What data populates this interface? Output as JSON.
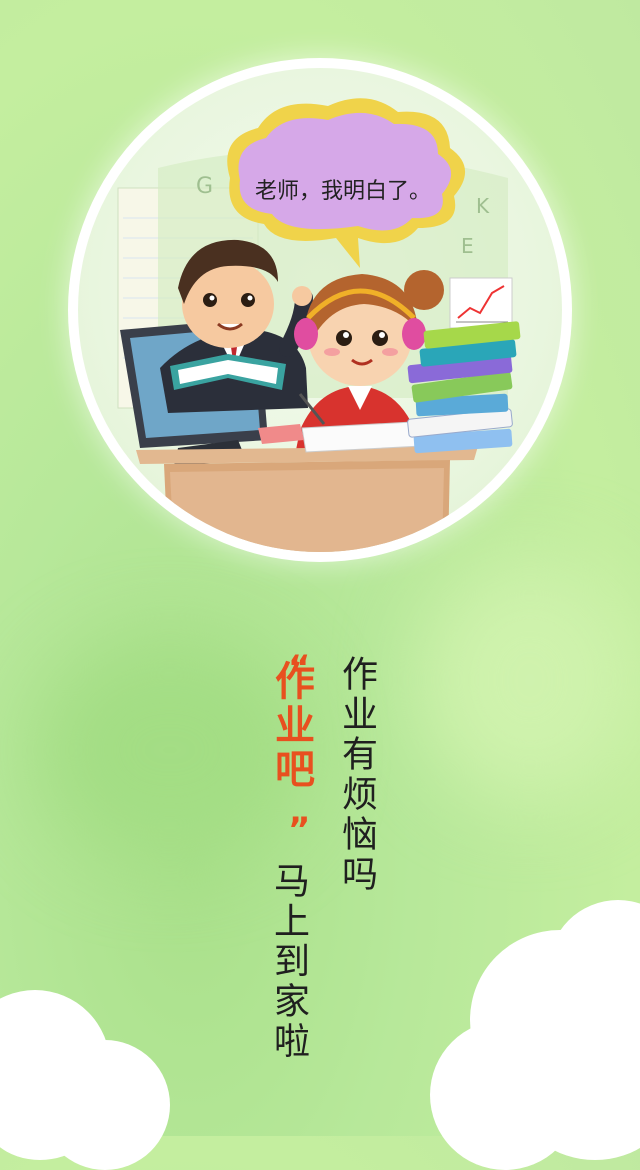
{
  "illustration": {
    "speech_bubble": "老师，我明白了。",
    "blackboard_letters": [
      "G",
      "K",
      "E"
    ]
  },
  "tagline": {
    "line1": "作业有烦恼吗",
    "brand": "作业吧",
    "quote_open": "“",
    "quote_close": "”",
    "line2": "马上到家啦"
  },
  "colors": {
    "background": "#bfe9a0",
    "brand": "#e8501f",
    "text": "#1f1f1f"
  }
}
